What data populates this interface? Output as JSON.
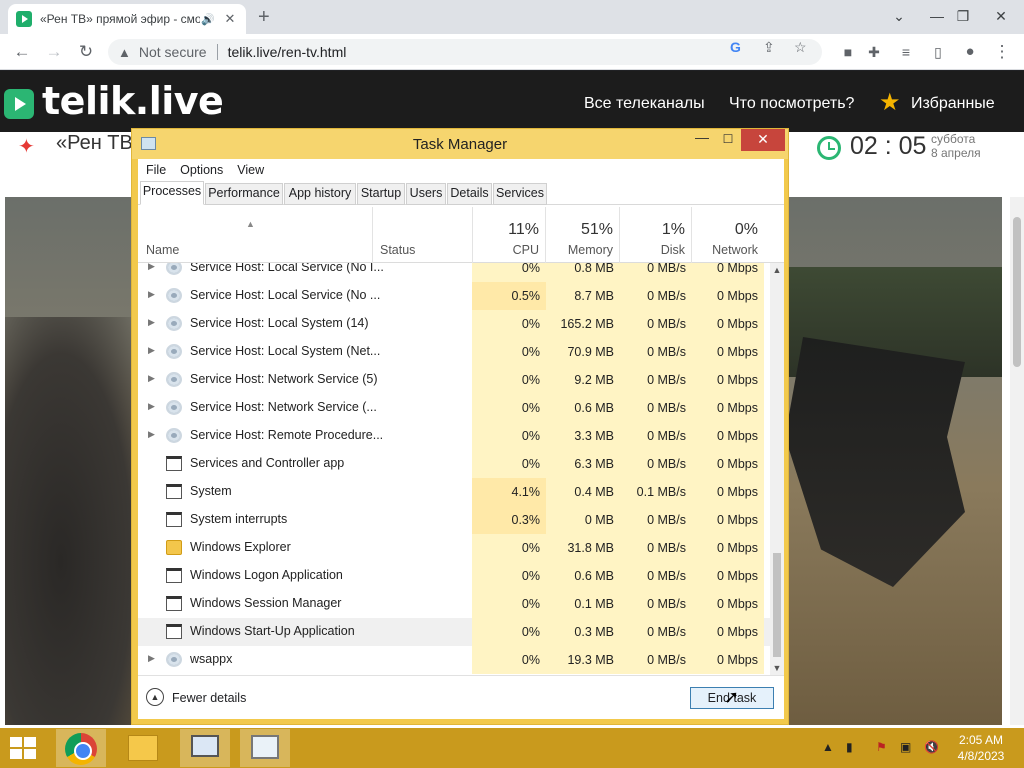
{
  "browser": {
    "tab_title": "«Рен ТВ» прямой эфир - смотреть",
    "address_security": "Not secure",
    "address_url": "telik.live/ren-tv.html"
  },
  "site": {
    "logo": "telik.live",
    "nav": [
      "Все телеканалы",
      "Что посмотреть?",
      "Избранные"
    ],
    "channel_name": "«Рен ТВ",
    "time": "02 : 05",
    "weekday": "суббота",
    "date": "8 апреля"
  },
  "task_manager": {
    "title": "Task Manager",
    "menu": [
      "File",
      "Options",
      "View"
    ],
    "tabs": [
      "Processes",
      "Performance",
      "App history",
      "Startup",
      "Users",
      "Details",
      "Services"
    ],
    "active_tab": "Processes",
    "headers": {
      "name": "Name",
      "status": "Status",
      "cpu_pct": "11%",
      "cpu": "CPU",
      "memory_pct": "51%",
      "memory": "Memory",
      "disk_pct": "1%",
      "disk": "Disk",
      "network_pct": "0%",
      "network": "Network"
    },
    "rows": [
      {
        "name": "Service Host: Local Service (No I...",
        "icon": "gear-icon",
        "expandable": true,
        "cpu": "0%",
        "memory": "0.8 MB",
        "disk": "0 MB/s",
        "network": "0 Mbps"
      },
      {
        "name": "Service Host: Local Service (No ...",
        "icon": "gear-icon",
        "expandable": true,
        "cpu": "0.5%",
        "memory": "8.7 MB",
        "disk": "0 MB/s",
        "network": "0 Mbps"
      },
      {
        "name": "Service Host: Local System (14)",
        "icon": "gear-icon",
        "expandable": true,
        "cpu": "0%",
        "memory": "165.2 MB",
        "disk": "0 MB/s",
        "network": "0 Mbps"
      },
      {
        "name": "Service Host: Local System (Net...",
        "icon": "gear-icon",
        "expandable": true,
        "cpu": "0%",
        "memory": "70.9 MB",
        "disk": "0 MB/s",
        "network": "0 Mbps"
      },
      {
        "name": "Service Host: Network Service (5)",
        "icon": "gear-icon",
        "expandable": true,
        "cpu": "0%",
        "memory": "9.2 MB",
        "disk": "0 MB/s",
        "network": "0 Mbps"
      },
      {
        "name": "Service Host: Network Service (...",
        "icon": "gear-icon",
        "expandable": true,
        "cpu": "0%",
        "memory": "0.6 MB",
        "disk": "0 MB/s",
        "network": "0 Mbps"
      },
      {
        "name": "Service Host: Remote Procedure...",
        "icon": "gear-icon",
        "expandable": true,
        "cpu": "0%",
        "memory": "3.3 MB",
        "disk": "0 MB/s",
        "network": "0 Mbps"
      },
      {
        "name": "Services and Controller app",
        "icon": "app-icon",
        "expandable": false,
        "cpu": "0%",
        "memory": "6.3 MB",
        "disk": "0 MB/s",
        "network": "0 Mbps"
      },
      {
        "name": "System",
        "icon": "app-icon",
        "expandable": false,
        "cpu": "4.1%",
        "memory": "0.4 MB",
        "disk": "0.1 MB/s",
        "network": "0 Mbps"
      },
      {
        "name": "System interrupts",
        "icon": "app-icon",
        "expandable": false,
        "cpu": "0.3%",
        "memory": "0 MB",
        "disk": "0 MB/s",
        "network": "0 Mbps"
      },
      {
        "name": "Windows Explorer",
        "icon": "folder-icon",
        "expandable": false,
        "cpu": "0%",
        "memory": "31.8 MB",
        "disk": "0 MB/s",
        "network": "0 Mbps"
      },
      {
        "name": "Windows Logon Application",
        "icon": "app-icon",
        "expandable": false,
        "cpu": "0%",
        "memory": "0.6 MB",
        "disk": "0 MB/s",
        "network": "0 Mbps"
      },
      {
        "name": "Windows Session Manager",
        "icon": "app-icon",
        "expandable": false,
        "cpu": "0%",
        "memory": "0.1 MB",
        "disk": "0 MB/s",
        "network": "0 Mbps"
      },
      {
        "name": "Windows Start-Up Application",
        "icon": "app-icon",
        "expandable": false,
        "cpu": "0%",
        "memory": "0.3 MB",
        "disk": "0 MB/s",
        "network": "0 Mbps",
        "selected": true
      },
      {
        "name": "wsappx",
        "icon": "gear-icon",
        "expandable": true,
        "cpu": "0%",
        "memory": "19.3 MB",
        "disk": "0 MB/s",
        "network": "0 Mbps"
      }
    ],
    "fewer_details": "Fewer details",
    "end_task": "End task"
  },
  "taskbar": {
    "time": "2:05 AM",
    "date": "4/8/2023"
  },
  "colors": {
    "task_manager_frame": "#f2c94c",
    "taskbar": "#c99a1d",
    "brand_green": "#2bb673",
    "column_highlight": "#fff4c4"
  }
}
